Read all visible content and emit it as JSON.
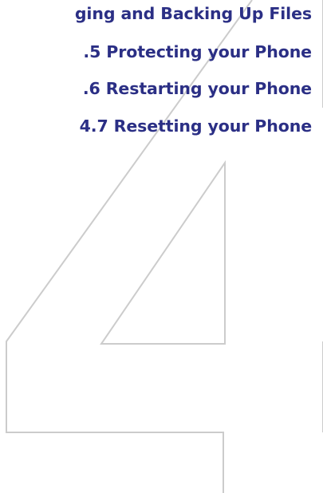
{
  "toc": {
    "items": [
      "ging and Backing Up Files",
      ".5  Protecting your Phone",
      ".6  Restarting your Phone",
      "4.7  Resetting your Phone"
    ]
  },
  "chapter_numeral": {
    "digit": "4",
    "style": "outline",
    "stroke_color": "#cccccc"
  },
  "colors": {
    "heading": "#2b2f85",
    "background": "#ffffff"
  }
}
